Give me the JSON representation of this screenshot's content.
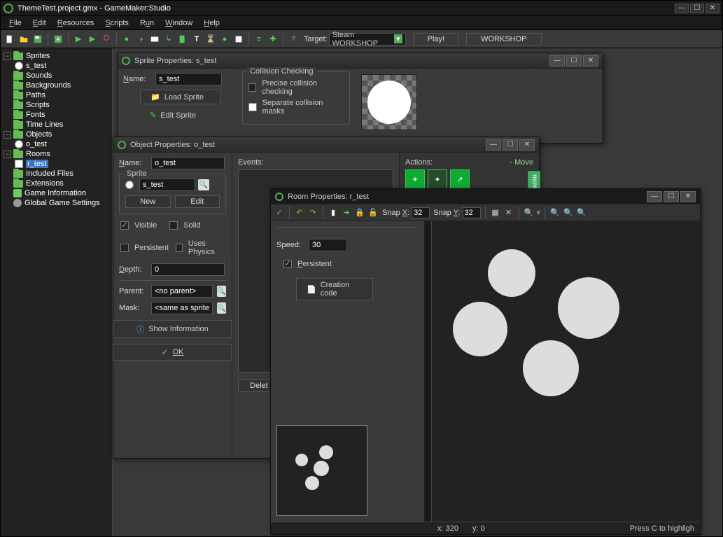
{
  "app": {
    "title": "ThemeTest.project.gmx - GameMaker:Studio"
  },
  "menu": {
    "file": "File",
    "edit": "Edit",
    "resources": "Resources",
    "scripts": "Scripts",
    "run": "Run",
    "window": "Window",
    "help": "Help"
  },
  "toolbar": {
    "target_label": "Target:",
    "target_value": "Steam WORKSHOP",
    "play": "Play!",
    "workshop": "WORKSHOP"
  },
  "tree": {
    "sprites": "Sprites",
    "s_test": "s_test",
    "sounds": "Sounds",
    "backgrounds": "Backgrounds",
    "paths": "Paths",
    "scripts": "Scripts",
    "fonts": "Fonts",
    "timelines": "Time Lines",
    "objects": "Objects",
    "o_test": "o_test",
    "rooms": "Rooms",
    "r_test": "r_test",
    "included": "Included Files",
    "extensions": "Extensions",
    "gameinfo": "Game Information",
    "globalsettings": "Global Game Settings"
  },
  "sprite_props": {
    "title": "Sprite Properties: s_test",
    "name_lbl": "Name:",
    "name_val": "s_test",
    "load": "Load Sprite",
    "edit": "Edit Sprite",
    "collision_legend": "Collision Checking",
    "precise": "Precise collision checking",
    "separate": "Separate collision masks"
  },
  "object_props": {
    "title": "Object Properties: o_test",
    "name_lbl": "Name:",
    "name_val": "o_test",
    "sprite_legend": "Sprite",
    "sprite_val": "s_test",
    "new_btn": "New",
    "edit_btn": "Edit",
    "visible": "Visible",
    "solid": "Solid",
    "persistent": "Persistent",
    "physics": "Uses Physics",
    "depth_lbl": "Depth:",
    "depth_val": "0",
    "parent_lbl": "Parent:",
    "parent_val": "<no parent>",
    "mask_lbl": "Mask:",
    "mask_val": "<same as sprite>",
    "showinfo": "Show Information",
    "ok": "OK",
    "events_lbl": "Events:",
    "actions_lbl": "Actions:",
    "move_tab": "- Move",
    "vtab": "move",
    "delete_btn": "Delet"
  },
  "room_props": {
    "title": "Room Properties: r_test",
    "snapx_lbl": "Snap X:",
    "snapx_val": "32",
    "snapy_lbl": "Snap Y:",
    "snapy_val": "32",
    "speed_lbl": "Speed:",
    "speed_val": "30",
    "persistent": "Persistent",
    "creation": "Creation code",
    "status_x": "x: 320",
    "status_y": "y: 0",
    "status_hint": "Press C to highligh"
  }
}
